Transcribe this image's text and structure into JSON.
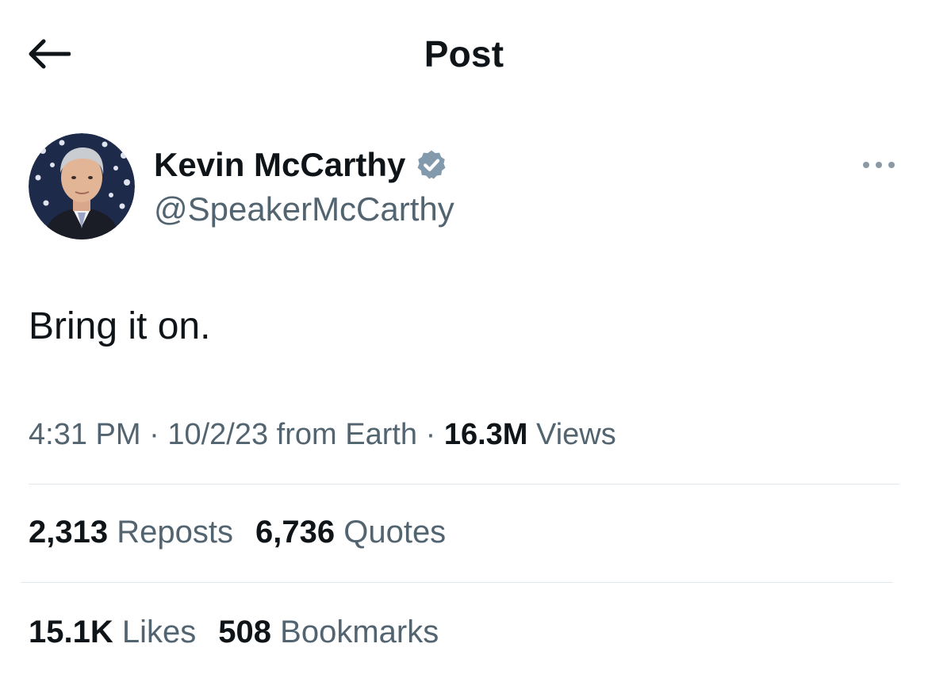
{
  "header": {
    "title": "Post",
    "back_icon": "arrow-left-icon"
  },
  "author": {
    "name": "Kevin McCarthy",
    "handle": "@SpeakerMcCarthy",
    "verified_icon": "verified-badge-icon",
    "verified_color": "#829aab"
  },
  "post": {
    "text": "Bring it on.",
    "time": "4:31 PM",
    "date": "10/2/23",
    "source": "from Earth",
    "views_count": "16.3M",
    "views_label": "Views"
  },
  "stats": {
    "reposts_count": "2,313",
    "reposts_label": "Reposts",
    "quotes_count": "6,736",
    "quotes_label": "Quotes",
    "likes_count": "15.1K",
    "likes_label": "Likes",
    "bookmarks_count": "508",
    "bookmarks_label": "Bookmarks"
  },
  "colors": {
    "text_primary": "#0f1419",
    "text_secondary": "#536471",
    "divider": "#e1e8ed"
  }
}
